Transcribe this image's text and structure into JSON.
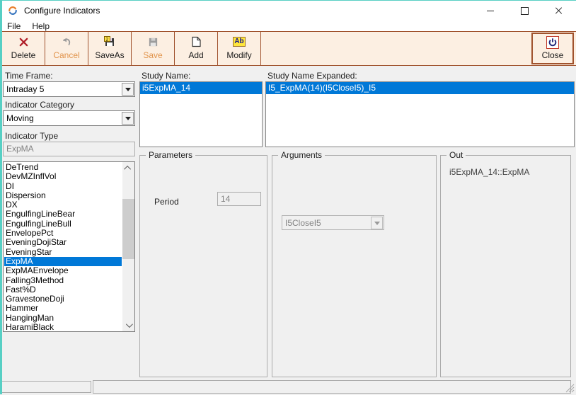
{
  "window": {
    "title": "Configure Indicators"
  },
  "menu": {
    "items": [
      {
        "label": "File"
      },
      {
        "label": "Help"
      }
    ]
  },
  "toolbar": {
    "buttons": [
      {
        "label": "Delete",
        "icon": "delete-x-icon",
        "enabled": true
      },
      {
        "label": "Cancel",
        "icon": "undo-arrow-icon",
        "enabled": false
      },
      {
        "label": "SaveAs",
        "icon": "save-as-icon",
        "enabled": true
      },
      {
        "label": "Save",
        "icon": "save-icon",
        "enabled": false
      },
      {
        "label": "Add",
        "icon": "new-document-icon",
        "enabled": true
      },
      {
        "label": "Modify",
        "icon": "rename-ab-icon",
        "icon_text": "Ab",
        "enabled": true
      }
    ],
    "close_label": "Close"
  },
  "left_panel": {
    "time_frame": {
      "label": "Time Frame:",
      "value": "Intraday 5"
    },
    "indicator_category": {
      "label": "Indicator Category",
      "value": "Moving"
    },
    "indicator_type": {
      "label": "Indicator Type",
      "value": "ExpMA"
    },
    "indicator_list": {
      "selected": "ExpMA",
      "items": [
        "DeTrend",
        "DevMZInflVol",
        "DI",
        "Dispersion",
        "DX",
        "EngulfingLineBear",
        "EngulfingLineBull",
        "EnvelopePct",
        "EveningDojiStar",
        "EveningStar",
        "ExpMA",
        "ExpMAEnvelope",
        "Falling3Method",
        "Fast%D",
        "GravestoneDoji",
        "Hammer",
        "HangingMan",
        "HaramiBlack"
      ]
    }
  },
  "study": {
    "name_label": "Study Name:",
    "name_value": "i5ExpMA_14",
    "expanded_label": "Study Name Expanded:",
    "expanded_value": "I5_ExpMA(14)(I5CloseI5)_I5"
  },
  "parameters": {
    "title": "Parameters",
    "period_label": "Period",
    "period_value": "14"
  },
  "arguments": {
    "title": "Arguments",
    "value": "I5CloseI5"
  },
  "out": {
    "title": "Out",
    "value": "i5ExpMA_14::ExpMA"
  },
  "colors": {
    "accent_teal": "#57cfc4",
    "toolbar_bg": "#fcefe2",
    "toolbar_border": "#a0522d",
    "disabled_label_orange": "#e1944c",
    "selection_blue": "#0078d7"
  }
}
